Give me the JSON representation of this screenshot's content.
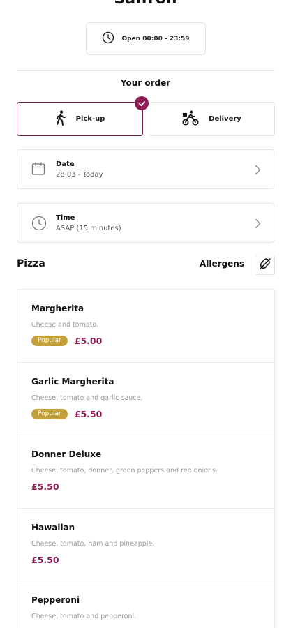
{
  "store": {
    "title": "Saffron"
  },
  "hours": {
    "icon": "clock-icon",
    "text": "Open 00:00 - 23:59"
  },
  "order": {
    "heading": "Your order",
    "modes": [
      {
        "label": "Pick-up",
        "icon": "walking-person-icon",
        "selected": true
      },
      {
        "label": "Delivery",
        "icon": "bicycle-courier-icon",
        "selected": false
      }
    ],
    "date": {
      "label": "Date",
      "value": "28.03 - Today"
    },
    "time": {
      "label": "Time",
      "value": "ASAP (15 minutes)"
    }
  },
  "menu": {
    "category": "Pizza",
    "allergens_label": "Allergens",
    "items": [
      {
        "name": "Margherita",
        "description": "Cheese and tomato.",
        "badge": "Popular",
        "price": "£5.00"
      },
      {
        "name": "Garlic Margherita",
        "description": "Cheese, tomato and garlic sauce.",
        "badge": "Popular",
        "price": "£5.50"
      },
      {
        "name": "Donner Deluxe",
        "description": "Cheese, tomato, donner, green peppers and red onions.",
        "badge": "",
        "price": "£5.50"
      },
      {
        "name": "Hawaiian",
        "description": "Cheese, tomato, ham and pineapple.",
        "badge": "",
        "price": "£5.50"
      },
      {
        "name": "Pepperoni",
        "description": "Cheese, tomato and pepperoni.",
        "badge": "",
        "price": ""
      }
    ]
  },
  "colors": {
    "accent": "#8b1a55",
    "popular_badge": "#c2a03c",
    "border": "#e3e3e3"
  }
}
